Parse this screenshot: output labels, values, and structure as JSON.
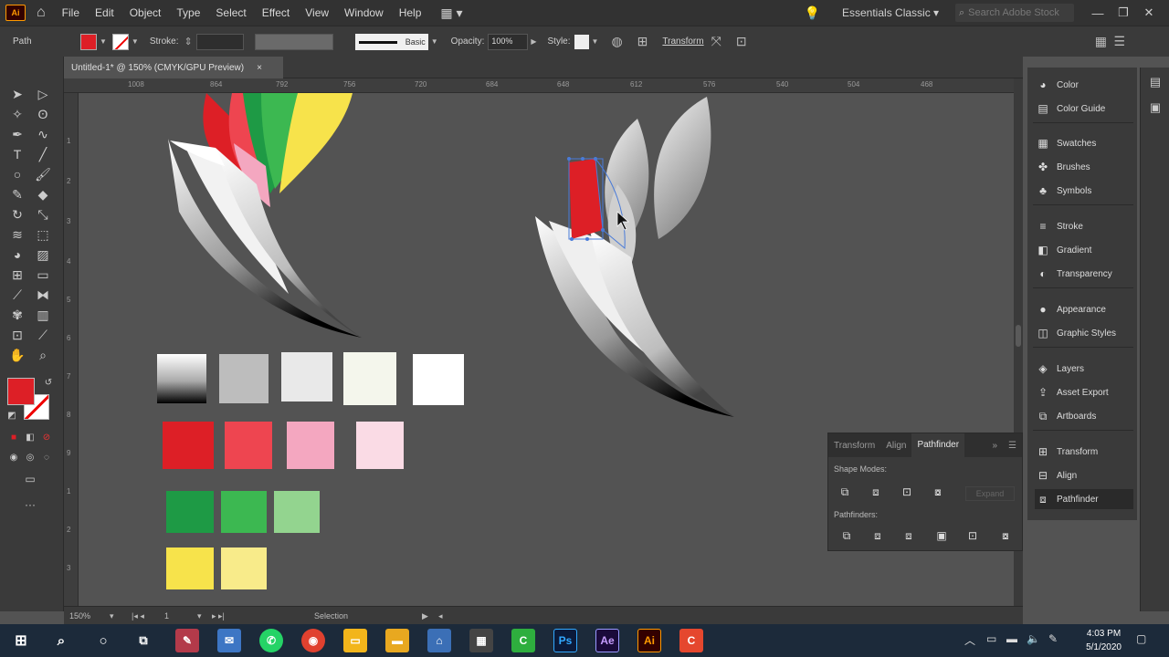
{
  "app": {
    "logo_text": "Ai",
    "menus": [
      "File",
      "Edit",
      "Object",
      "Type",
      "Select",
      "Effect",
      "View",
      "Window",
      "Help"
    ],
    "workspace": "Essentials Classic",
    "search_placeholder": "Search Adobe Stock",
    "window_controls": [
      "—",
      "❐",
      "✕"
    ]
  },
  "control_bar": {
    "selection_label": "Path",
    "stroke_label": "Stroke:",
    "stroke_style": "Basic",
    "opacity_label": "Opacity:",
    "opacity_value": "100%",
    "style_label": "Style:",
    "transform_label": "Transform",
    "fill_color": "#dd1f26"
  },
  "document": {
    "tab_title": "Untitled-1* @ 150% (CMYK/GPU Preview)",
    "close": "×"
  },
  "rulers": {
    "top": [
      "1008",
      "864",
      "792",
      "756",
      "720",
      "684",
      "648",
      "612",
      "576",
      "540",
      "504",
      "468"
    ],
    "left": [
      "1",
      "2",
      "3",
      "4",
      "5",
      "6",
      "7",
      "8",
      "9",
      "1",
      "2",
      "3"
    ]
  },
  "status_bar": {
    "zoom": "150%",
    "artboard": "1",
    "mode": "Selection"
  },
  "panels": [
    {
      "icon": "color-icon",
      "glyph": "◕",
      "label": "Color"
    },
    {
      "icon": "color-guide-icon",
      "glyph": "▤",
      "label": "Color Guide"
    },
    {
      "icon": "swatches-icon",
      "glyph": "▦",
      "label": "Swatches"
    },
    {
      "icon": "brushes-icon",
      "glyph": "✤",
      "label": "Brushes"
    },
    {
      "icon": "symbols-icon",
      "glyph": "♣",
      "label": "Symbols"
    },
    {
      "icon": "stroke-icon",
      "glyph": "≡",
      "label": "Stroke"
    },
    {
      "icon": "gradient-icon",
      "glyph": "◧",
      "label": "Gradient"
    },
    {
      "icon": "transparency-icon",
      "glyph": "◐",
      "label": "Transparency"
    },
    {
      "icon": "appearance-icon",
      "glyph": "●",
      "label": "Appearance"
    },
    {
      "icon": "graphic-styles-icon",
      "glyph": "◫",
      "label": "Graphic Styles"
    },
    {
      "icon": "layers-icon",
      "glyph": "◈",
      "label": "Layers"
    },
    {
      "icon": "asset-export-icon",
      "glyph": "⇪",
      "label": "Asset Export"
    },
    {
      "icon": "artboards-icon",
      "glyph": "⧉",
      "label": "Artboards"
    },
    {
      "icon": "transform-icon",
      "glyph": "⊞",
      "label": "Transform"
    },
    {
      "icon": "align-icon",
      "glyph": "⊟",
      "label": "Align"
    },
    {
      "icon": "pathfinder-icon",
      "glyph": "⧈",
      "label": "Pathfinder"
    }
  ],
  "pathfinder": {
    "tabs": [
      "Transform",
      "Align",
      "Pathfinder"
    ],
    "shape_modes_label": "Shape Modes:",
    "pathfinders_label": "Pathfinders:",
    "expand_label": "Expand"
  },
  "swatches": {
    "grays": [
      "#f6f6f6",
      "#bdbdbd",
      "#e9e9e9",
      "#f4f6ec",
      "#ffffff"
    ],
    "reds": [
      "#dd1f26",
      "#ee4550",
      "#f4a7c0",
      "#fadbe5"
    ],
    "greens": [
      "#1e9a45",
      "#3cb851",
      "#93d48f"
    ],
    "yellows": [
      "#f7e34b",
      "#f8eb8a"
    ]
  },
  "taskbar": {
    "time": "4:03 PM",
    "date": "5/1/2020"
  }
}
